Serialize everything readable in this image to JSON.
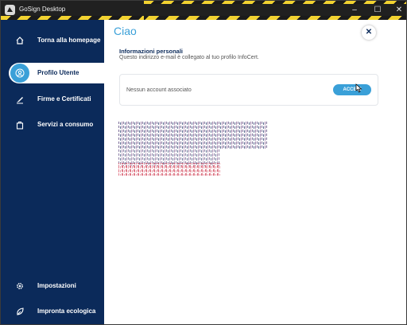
{
  "window": {
    "title": "GoSign Desktop",
    "controls": {
      "minimize": "–",
      "maximize": "☐",
      "close": "✕"
    }
  },
  "sidebar": {
    "items": [
      {
        "label": "Torna alla homepage",
        "icon": "home-icon"
      },
      {
        "label": "Profilo Utente",
        "icon": "user-icon",
        "active": true
      },
      {
        "label": "Firme e Certificati",
        "icon": "signature-icon"
      },
      {
        "label": "Servizi a consumo",
        "icon": "bag-icon"
      }
    ],
    "bottom_items": [
      {
        "label": "Impostazioni",
        "icon": "gear-icon"
      },
      {
        "label": "Impronta ecologica",
        "icon": "leaf-icon"
      }
    ]
  },
  "main": {
    "title": "Ciao",
    "close_label": "✕",
    "section": {
      "title": "Informazioni personali",
      "description": "Questo indirizzo e-mail è collegato al tuo profilo InfoCert."
    },
    "account_card": {
      "text": "Nessun account associato",
      "button_label": "ACCEDI"
    }
  },
  "colors": {
    "sidebar_bg": "#0b2a5a",
    "accent": "#3aa0d8",
    "titlebar_bg": "#202020",
    "stripe_yellow": "#f2d230"
  }
}
